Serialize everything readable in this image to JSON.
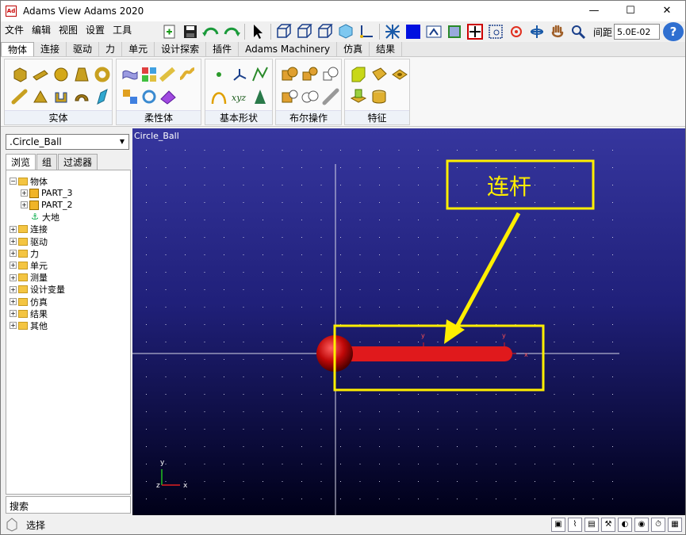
{
  "window": {
    "title": "Adams View Adams 2020",
    "app_icon": "Ad",
    "minimize": "—",
    "maximize": "☐",
    "close": "✕"
  },
  "menu": [
    "文件",
    "编辑",
    "视图",
    "设置",
    "工具"
  ],
  "toolbar": {
    "spacing_label": "间距",
    "spacing_value": "5.0E-02",
    "help": "?"
  },
  "tabs": [
    "物体",
    "连接",
    "驱动",
    "力",
    "单元",
    "设计探索",
    "插件",
    "Adams Machinery",
    "仿真",
    "结果"
  ],
  "ribbon_groups": [
    "实体",
    "柔性体",
    "基本形状",
    "布尔操作",
    "特征"
  ],
  "browser": {
    "combo_value": ".Circle_Ball",
    "subtabs": [
      "浏览",
      "组",
      "过滤器"
    ],
    "tree": [
      {
        "label": "物体",
        "kind": "folder",
        "exp": "−"
      },
      {
        "label": "PART_3",
        "kind": "part",
        "exp": "+"
      },
      {
        "label": "PART_2",
        "kind": "part",
        "exp": "+"
      },
      {
        "label": "大地",
        "kind": "ground",
        "exp": ""
      },
      {
        "label": "连接",
        "kind": "folder",
        "exp": "+"
      },
      {
        "label": "驱动",
        "kind": "folder",
        "exp": "+"
      },
      {
        "label": "力",
        "kind": "folder",
        "exp": "+"
      },
      {
        "label": "单元",
        "kind": "folder",
        "exp": "+"
      },
      {
        "label": "测量",
        "kind": "folder",
        "exp": "+"
      },
      {
        "label": "设计变量",
        "kind": "folder",
        "exp": "+"
      },
      {
        "label": "仿真",
        "kind": "folder",
        "exp": "+"
      },
      {
        "label": "结果",
        "kind": "folder",
        "exp": "+"
      },
      {
        "label": "其他",
        "kind": "folder",
        "exp": "+"
      }
    ],
    "search_label": "搜索"
  },
  "viewport": {
    "title": "Circle_Ball",
    "annotation": "连杆",
    "triad": {
      "x": "x",
      "y": "y",
      "z": "z"
    },
    "marker_x": "x",
    "marker_y": "y",
    "annotation_color": "#ffee00",
    "part_color": "#e0191c"
  },
  "status": {
    "text": "选择"
  }
}
